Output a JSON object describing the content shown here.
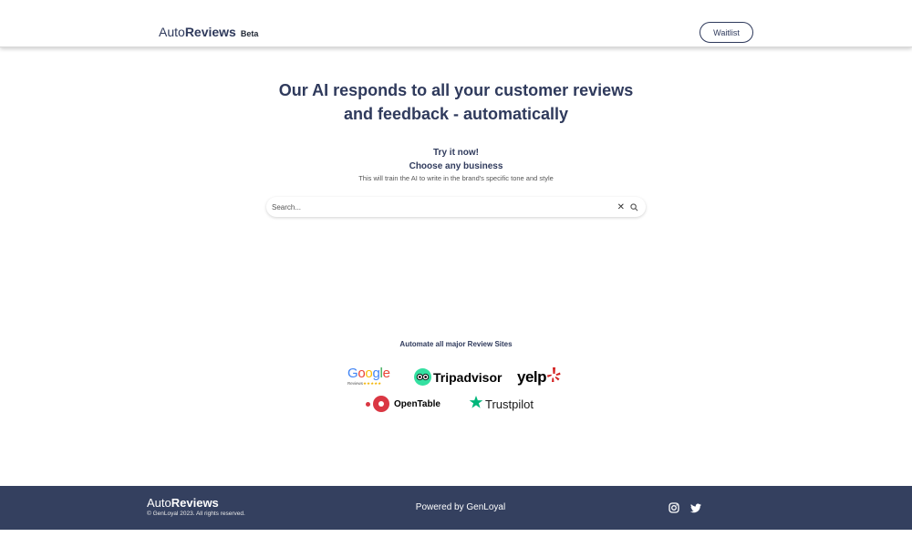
{
  "header": {
    "brand_light": "Auto",
    "brand_bold": "Reviews",
    "badge": "Beta",
    "waitlist_label": "Waitlist"
  },
  "hero": {
    "title_line1": "Our AI responds to all your customer reviews",
    "title_line2": "and feedback - automatically",
    "try_label": "Try it now!",
    "choose_label": "Choose any business",
    "subtitle": "This will train the AI to write in the brand's specific tone and style"
  },
  "search": {
    "placeholder": "Search...",
    "value": "",
    "clear_icon": "close-icon",
    "search_icon": "search-icon"
  },
  "review_sites": {
    "heading": "Automate all major Review Sites",
    "sites": [
      {
        "name": "Google",
        "sub": "Reviews",
        "stars": "★★★★★"
      },
      {
        "name": "Tripadvisor"
      },
      {
        "name": "yelp"
      },
      {
        "name": "OpenTable"
      },
      {
        "name": "Trustpilot"
      }
    ]
  },
  "footer": {
    "brand_light": "Auto",
    "brand_bold": "Reviews",
    "copyright": "© GenLoyal 2023. All rights reserved.",
    "powered_by": "Powered by GenLoyal",
    "social": [
      "instagram-icon",
      "twitter-icon"
    ]
  },
  "colors": {
    "navy": "#2f3a5c",
    "footer_bg": "#34405f",
    "tripadvisor_green": "#34e0a1",
    "yelp_red": "#d32323",
    "opentable_red": "#da3743",
    "trustpilot_green": "#00b67a"
  }
}
